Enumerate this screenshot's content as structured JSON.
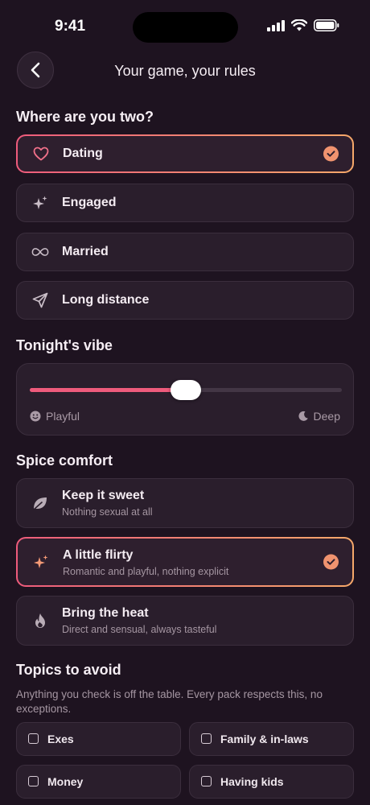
{
  "status_bar": {
    "time": "9:41"
  },
  "header": {
    "title": "Your game, your rules"
  },
  "relationship": {
    "title": "Where are you two?",
    "options": [
      {
        "label": "Dating",
        "icon": "heart-icon",
        "selected": true
      },
      {
        "label": "Engaged",
        "icon": "sparkle-icon",
        "selected": false
      },
      {
        "label": "Married",
        "icon": "infinity-icon",
        "selected": false
      },
      {
        "label": "Long distance",
        "icon": "paper-plane-icon",
        "selected": false
      }
    ]
  },
  "vibe": {
    "title": "Tonight's vibe",
    "left_label": "Playful",
    "right_label": "Deep",
    "value": 0.5
  },
  "spice": {
    "title": "Spice comfort",
    "options": [
      {
        "title": "Keep it sweet",
        "subtitle": "Nothing sexual at all",
        "icon": "leaf-icon",
        "selected": false
      },
      {
        "title": "A little flirty",
        "subtitle": "Romantic and playful, nothing explicit",
        "icon": "sparkle-icon",
        "selected": true
      },
      {
        "title": "Bring the heat",
        "subtitle": "Direct and sensual, always tasteful",
        "icon": "flame-icon",
        "selected": false
      }
    ]
  },
  "topics": {
    "title": "Topics to avoid",
    "description": "Anything you check is off the table. Every pack respects this, no exceptions.",
    "items": [
      {
        "label": "Exes",
        "checked": false
      },
      {
        "label": "Family & in-laws",
        "checked": false
      },
      {
        "label": "Money",
        "checked": false
      },
      {
        "label": "Having kids",
        "checked": false
      }
    ]
  },
  "colors": {
    "accent_start": "#ee5b7c",
    "accent_end": "#f6a86a",
    "background": "#1e1320",
    "card": "#2a1e2c"
  }
}
